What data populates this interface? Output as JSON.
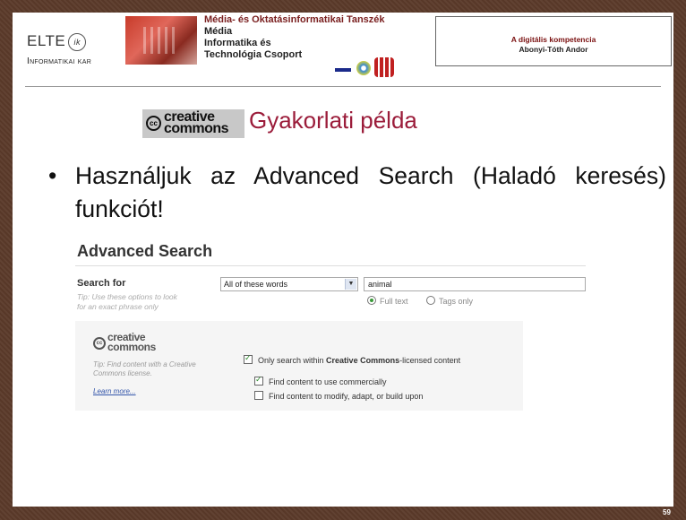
{
  "header": {
    "elte_name": "ELTE",
    "elte_faculty": "Informatikai kar",
    "dept_lines": [
      "Média- és Oktatásinformatikai Tanszék",
      "Média",
      "Informatika és",
      "Technológia Csoport"
    ],
    "course_title": "A digitális kompetencia",
    "author": "Abonyi-Tóth Andor"
  },
  "slide": {
    "cc_logo_line1": "creative",
    "cc_logo_line2": "commons",
    "title": "Gyakorlati példa",
    "bullet": "Használjuk az Advanced Search (Haladó keresés) funkciót!",
    "page_number": "59"
  },
  "screenshot": {
    "heading": "Advanced Search",
    "search_for_label": "Search for",
    "tip1": "Tip: Use these options to look for an exact phrase only",
    "select_value": "All of these words",
    "input_value": "animal",
    "radio_full_text": "Full text",
    "radio_tags_only": "Tags only",
    "cc_logo_line1": "creative",
    "cc_logo_line2": "commons",
    "tip2": "Tip: Find content with a Creative Commons license.",
    "learn_more": "Learn more...",
    "check_cc_prefix": "Only search within",
    "check_cc_bold": "Creative Commons",
    "check_cc_suffix": "-licensed content",
    "check_commercial": "Find content to use commercially",
    "check_modify": "Find content to modify, adapt, or build upon"
  }
}
